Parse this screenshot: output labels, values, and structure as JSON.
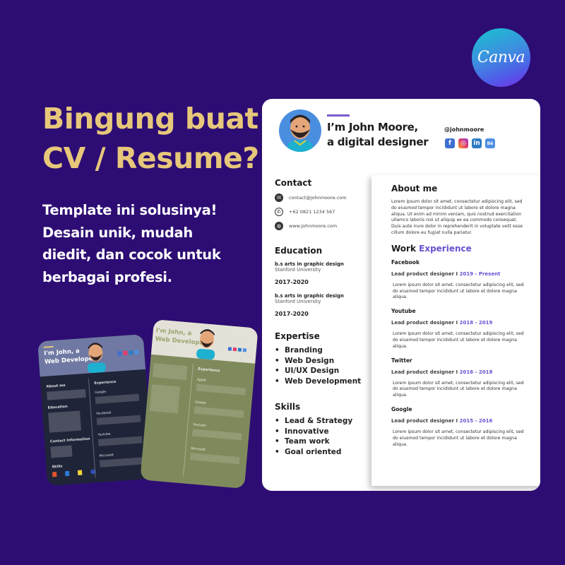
{
  "brand": {
    "logo_text": "Canva",
    "logo_icon": "canva-logo-icon"
  },
  "headline": {
    "line1": "Bingung buat",
    "line2": "CV / Resume?"
  },
  "subtext": {
    "line1": "Template ini solusinya!",
    "line2": "Desain unik, mudah",
    "line3": "diedit, dan cocok untuk",
    "line4": "berbagai profesi."
  },
  "colors": {
    "background": "#2d0d73",
    "headline": "#e7c77a",
    "accent": "#6a4fd0"
  },
  "resume": {
    "name_line1": "I’m John Moore,",
    "name_line2": "a digital designer",
    "handle": "@johnmoore",
    "socials": [
      {
        "icon": "facebook-icon",
        "glyph": "f"
      },
      {
        "icon": "instagram-icon",
        "glyph": "◎"
      },
      {
        "icon": "linkedin-icon",
        "glyph": "in"
      },
      {
        "icon": "behance-icon",
        "glyph": "Bē"
      }
    ],
    "contact": {
      "title": "Contact",
      "email": "contact@johnmoore.com",
      "phone": "+62 0821 1234 567",
      "website": "www.johnmoore.com"
    },
    "education": {
      "title": "Education",
      "items": [
        {
          "degree": "b.s arts in graphic design",
          "school": "Stanford University",
          "years": "2017-2020"
        },
        {
          "degree": "b.s arts in graphic design",
          "school": "Stanford University",
          "years": "2017-2020"
        }
      ]
    },
    "expertise": {
      "title": "Expertise",
      "items": [
        "Branding",
        "Web Design",
        "UI/UX Design",
        "Web Development"
      ]
    },
    "skills": {
      "title": "Skills",
      "items": [
        "Lead & Strategy",
        "Innovative",
        "Team work",
        "Goal oriented"
      ]
    },
    "about": {
      "title": "About me",
      "text": "Lorem ipsum dolor sit amet, consectetur adipiscing elit, sed do eiusmod tempor incididunt ut labore et dolore magna aliqua. Ut enim ad minim veniam, quis nostrud exercitation ullamco laboris nisi ut aliquip ex ea commodo consequat. Duis aute irure dolor in reprehenderit in voluptate velit esse cillum dolore eu fugiat nulla pariatur."
    },
    "work": {
      "title_main": "Work",
      "title_accent": "Experience",
      "jobs": [
        {
          "company": "Facebook",
          "role": "Lead product designer I",
          "years": "2019 - Present",
          "desc": "Lorem ipsum dolor sit amet, consectetur adipiscing elit, sed do eiusmod tempor incididunt ut labore et dolore magna aliqua."
        },
        {
          "company": "Youtube",
          "role": "Lead product designer I",
          "years": "2018 - 2019",
          "desc": "Lorem ipsum dolor sit amet, consectetur adipiscing elit, sed do eiusmod tempor incididunt ut labore et dolore magna aliqua."
        },
        {
          "company": "Twitter",
          "role": "Lead product designer I",
          "years": "2016 - 2018",
          "desc": "Lorem ipsum dolor sit amet, consectetur adipiscing elit, sed do eiusmod tempor incididunt ut labore et dolore magna aliqua."
        },
        {
          "company": "Google",
          "role": "Lead product designer I",
          "years": "2015 - 2016",
          "desc": "Lorem ipsum dolor sit amet, consectetur adipiscing elit, sed do eiusmod tempor incididunt ut labore et dolore magna aliqua."
        }
      ]
    }
  },
  "thumbnails": {
    "dark": {
      "name_line1": "I'm John, a",
      "name_line2": "Web Developer",
      "about": "About me",
      "education": "Education",
      "contact": "Contact Information",
      "experience": "Experience",
      "skills": "Skills",
      "jobs": [
        "Google",
        "Facebook",
        "Youtube",
        "Microsoft"
      ]
    },
    "green": {
      "name_line1": "I'm John, a",
      "name_line2": "Web Developer",
      "experience": "Experience",
      "jobs": [
        "Apple",
        "Google",
        "Youtube",
        "Microsoft"
      ]
    }
  }
}
